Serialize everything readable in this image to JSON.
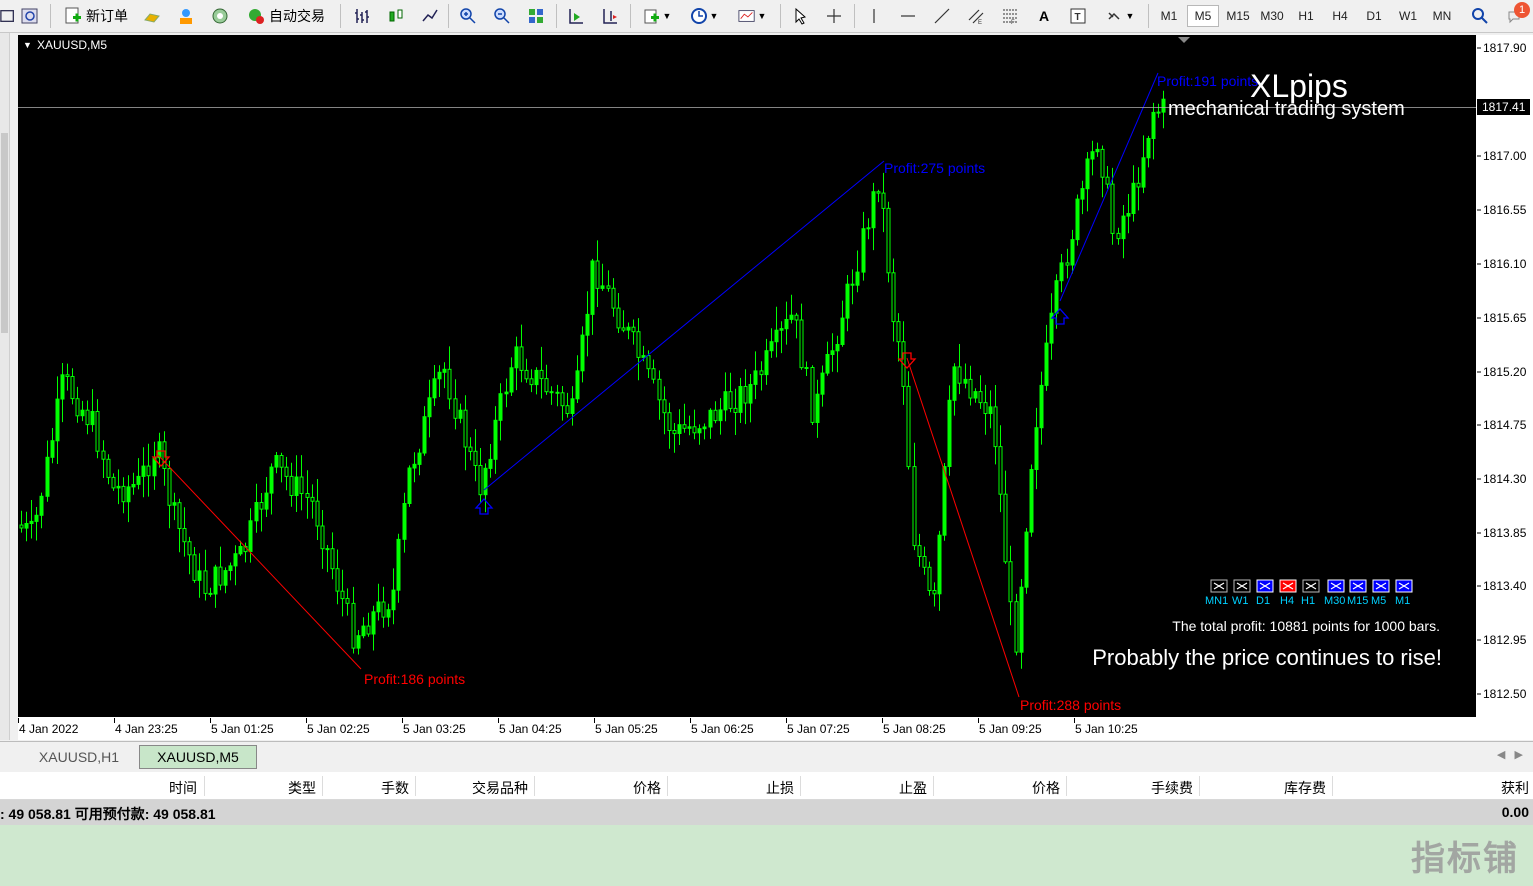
{
  "toolbar": {
    "new_order_label": "新订单",
    "auto_trade_label": "自动交易",
    "timeframes": [
      "M1",
      "M5",
      "M15",
      "M30",
      "H1",
      "H4",
      "D1",
      "W1",
      "MN"
    ],
    "active_timeframe": "M5",
    "notification_count": "1"
  },
  "chart": {
    "symbol_label": "XAUUSD,M5",
    "brand_title": "XLpips",
    "brand_subtitle": "mechanical trading system",
    "total_profit_text": "The total profit: 10881 points for 1000 bars.",
    "forecast_text": "Probably the price continues to rise!",
    "current_price_label": "1817.41",
    "price_ticks": [
      "1817.90",
      "1817.00",
      "1816.55",
      "1816.10",
      "1815.65",
      "1815.20",
      "1814.75",
      "1814.30",
      "1813.85",
      "1813.40",
      "1812.95",
      "1812.50"
    ],
    "time_ticks": [
      "4 Jan 2022",
      "4 Jan 23:25",
      "5 Jan 01:25",
      "5 Jan 02:25",
      "5 Jan 03:25",
      "5 Jan 04:25",
      "5 Jan 05:25",
      "5 Jan 06:25",
      "5 Jan 07:25",
      "5 Jan 08:25",
      "5 Jan 09:25",
      "5 Jan 10:25"
    ],
    "trades": [
      {
        "label": "Profit:186 points",
        "direction": "sell",
        "color": "#ff0000"
      },
      {
        "label": "Profit:275 points",
        "direction": "buy",
        "color": "#0000ff"
      },
      {
        "label": "Profit:288 points",
        "direction": "sell",
        "color": "#ff0000"
      },
      {
        "label": "Profit:191 points",
        "direction": "buy",
        "color": "#0000ff"
      }
    ],
    "signal_panel": [
      {
        "tf": "MN1",
        "state": "none"
      },
      {
        "tf": "W1",
        "state": "none"
      },
      {
        "tf": "D1",
        "state": "buy"
      },
      {
        "tf": "H4",
        "state": "sell"
      },
      {
        "tf": "H1",
        "state": "none"
      },
      {
        "tf": "M30",
        "state": "buy"
      },
      {
        "tf": "M15",
        "state": "buy"
      },
      {
        "tf": "M5",
        "state": "buy"
      },
      {
        "tf": "M1",
        "state": "buy"
      }
    ],
    "colors": {
      "background": "#000000",
      "candle": "#00ff00",
      "buy": "#0000ff",
      "sell": "#ff0000",
      "text": "#ffffff",
      "grid_label": "#000000"
    }
  },
  "tabs": [
    {
      "label": "XAUUSD,H1",
      "active": false
    },
    {
      "label": "XAUUSD,M5",
      "active": true
    }
  ],
  "terminal": {
    "columns": [
      "时间",
      "类型",
      "手数",
      "交易品种",
      "价格",
      "止损",
      "止盈",
      "价格",
      "手续费",
      "库存费",
      "获利"
    ],
    "balance_text": ": 49 058.81  可用预付款: 49 058.81",
    "balance_profit": "0.00"
  },
  "watermark": "指标铺"
}
